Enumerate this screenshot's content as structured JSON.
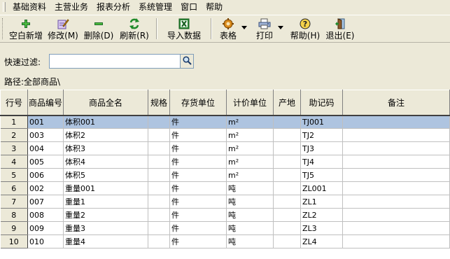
{
  "menu": [
    "基础资料",
    "主营业务",
    "报表分析",
    "系统管理",
    "窗口",
    "帮助"
  ],
  "toolbar": {
    "new_label": "空白新增",
    "edit_label": "修改(M)",
    "delete_label": "删除(D)",
    "refresh_label": "刷新(R)",
    "import_label": "导入数据",
    "table_label": "表格",
    "print_label": "打印",
    "help_label": "帮助(H)",
    "exit_label": "退出(E)"
  },
  "filter": {
    "label": "快速过滤:",
    "value": ""
  },
  "path": {
    "label": "路径:",
    "value": "全部商品\\"
  },
  "table": {
    "columns": [
      "行号",
      "商品编号",
      "商品全名",
      "规格",
      "存货单位",
      "计价单位",
      "产地",
      "助记码",
      "备注"
    ],
    "rows": [
      [
        "1",
        "001",
        "体积001",
        "",
        "件",
        "m²",
        "",
        "TJ001",
        ""
      ],
      [
        "2",
        "003",
        "体积2",
        "",
        "件",
        "m²",
        "",
        "TJ2",
        ""
      ],
      [
        "3",
        "004",
        "体积3",
        "",
        "件",
        "m²",
        "",
        "TJ3",
        ""
      ],
      [
        "4",
        "005",
        "体积4",
        "",
        "件",
        "m²",
        "",
        "TJ4",
        ""
      ],
      [
        "5",
        "006",
        "体积5",
        "",
        "件",
        "m²",
        "",
        "TJ5",
        ""
      ],
      [
        "6",
        "002",
        "重量001",
        "",
        "件",
        "吨",
        "",
        "ZL001",
        ""
      ],
      [
        "7",
        "007",
        "重量1",
        "",
        "件",
        "吨",
        "",
        "ZL1",
        ""
      ],
      [
        "8",
        "008",
        "重量2",
        "",
        "件",
        "吨",
        "",
        "ZL2",
        ""
      ],
      [
        "9",
        "009",
        "重量3",
        "",
        "件",
        "吨",
        "",
        "ZL3",
        ""
      ],
      [
        "10",
        "010",
        "重量4",
        "",
        "件",
        "吨",
        "",
        "ZL4",
        ""
      ]
    ],
    "selected_row": 0
  },
  "icons": {
    "new": "plus-icon",
    "edit": "edit-icon",
    "delete": "minus-icon",
    "refresh": "refresh-icon",
    "import": "excel-icon",
    "table": "gear-icon",
    "print": "printer-icon",
    "help": "help-icon",
    "exit": "exit-door-icon",
    "search": "search-icon"
  },
  "colors": {
    "selection": "#aec4e0",
    "chrome": "#ece9d8",
    "input_border": "#7f9db9"
  }
}
